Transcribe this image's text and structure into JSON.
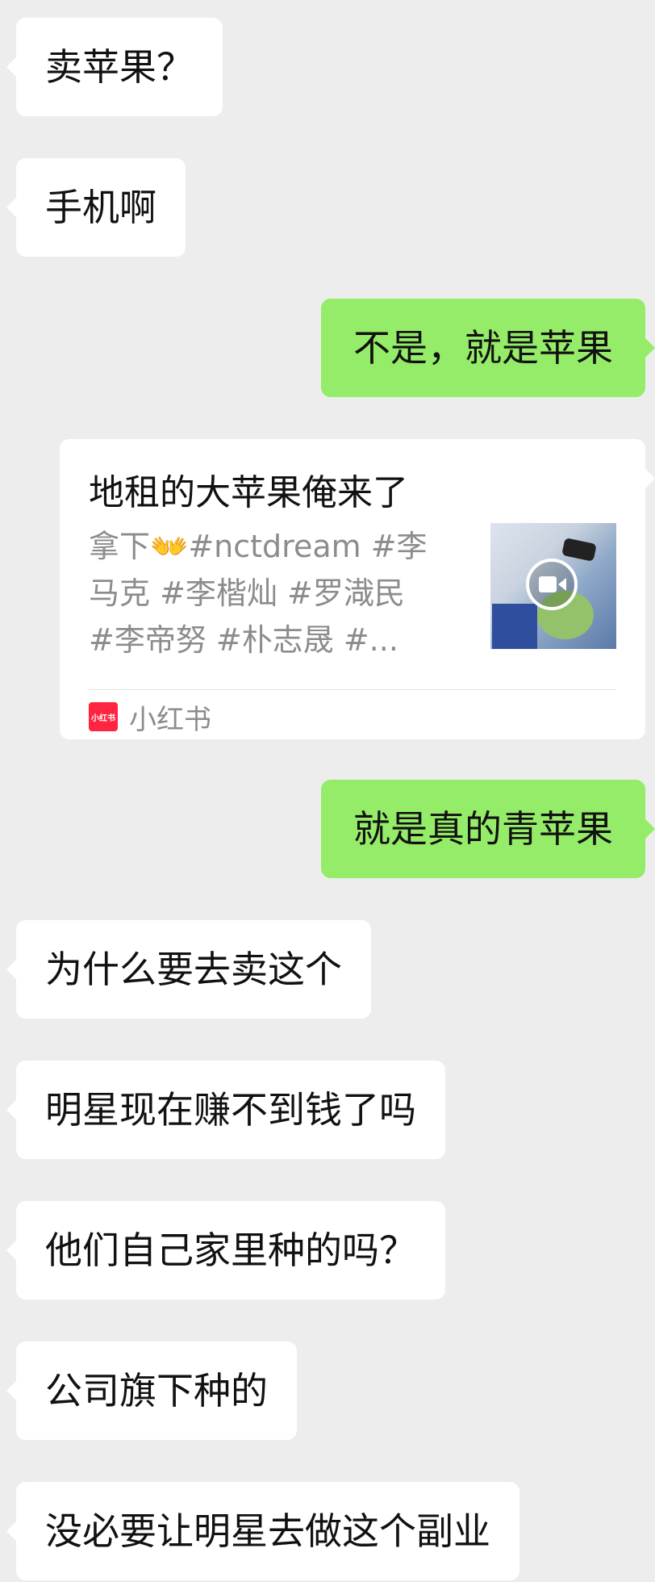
{
  "messages": [
    {
      "side": "in",
      "text": "卖苹果？"
    },
    {
      "side": "in",
      "text": "手机啊"
    },
    {
      "side": "out",
      "text": "不是，就是苹果"
    },
    {
      "side": "out",
      "text": "就是真的青苹果"
    },
    {
      "side": "in",
      "text": "为什么要去卖这个"
    },
    {
      "side": "in",
      "text": "明星现在赚不到钱了吗"
    },
    {
      "side": "in",
      "text": "他们自己家里种的吗？"
    },
    {
      "side": "in",
      "text": "公司旗下种的"
    },
    {
      "side": "in",
      "text": "没必要让明星去做这个副业"
    }
  ],
  "share_card": {
    "title": "地租的大苹果俺来了",
    "desc_lines": [
      "拿下👐#nctdream #李",
      "马克 #李楷灿 #罗渽民",
      "#李帝努 #朴志晟 #..."
    ],
    "thumbnail_icon": "video-camera-icon",
    "source_logo_text": "小红书",
    "source_name": "小红书"
  },
  "colors": {
    "background": "#ededed",
    "incoming_bubble": "#ffffff",
    "outgoing_bubble": "#95ec69",
    "brand_red": "#ff2442"
  }
}
